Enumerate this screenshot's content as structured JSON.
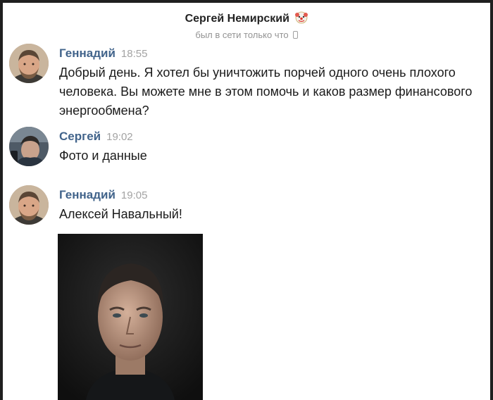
{
  "header": {
    "contact_name": "Сергей Немирский",
    "contact_emoji_icon": "clown-face-icon",
    "status": "был в сети только что",
    "device_icon": "mobile-phone-icon"
  },
  "messages": [
    {
      "author": "Геннадий",
      "time": "18:55",
      "text": "Добрый день. Я хотел бы уничтожить порчей одного очень плохого человека. Вы можете мне в этом помочь и каков размер финансового энергообмена?"
    },
    {
      "author": "Сергей",
      "time": "19:02",
      "text": "Фото и данные"
    },
    {
      "author": "Геннадий",
      "time": "19:05",
      "text": "Алексей Навальный!",
      "attachment": "photo"
    }
  ],
  "colors": {
    "author": "#42648b",
    "time": "#a3a3a3",
    "text": "#1a1a1a",
    "frame": "#1f1f1f"
  }
}
